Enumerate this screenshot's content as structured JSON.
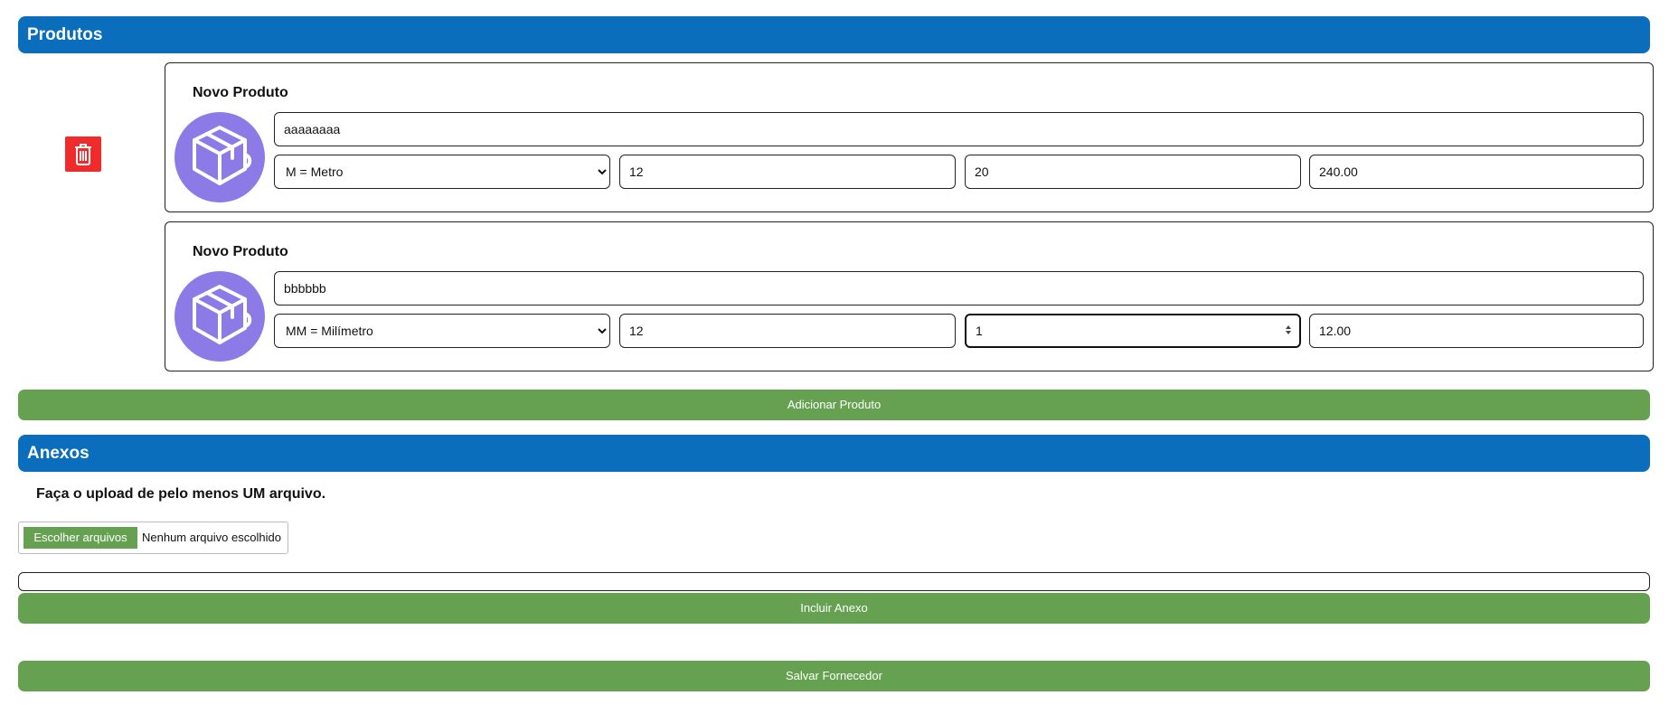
{
  "produtos": {
    "header": "Produtos",
    "items": [
      {
        "title": "Novo Produto",
        "name": "aaaaaaaa",
        "unit": "M = Metro",
        "quantity": "12",
        "price": "20",
        "total": "240.00"
      },
      {
        "title": "Novo Produto",
        "name": "bbbbbb",
        "unit": "MM = Milímetro",
        "quantity": "12",
        "price": "1",
        "total": "12.00"
      }
    ],
    "add_button": "Adicionar Produto"
  },
  "anexos": {
    "header": "Anexos",
    "upload_message": "Faça o upload de pelo menos UM arquivo.",
    "choose_files": "Escolher arquivos",
    "no_file": "Nenhum arquivo escolhido",
    "include_button": "Incluir Anexo"
  },
  "save_button": "Salvar Fornecedor",
  "colors": {
    "header_blue": "#0a6ebd",
    "button_green": "#66a152",
    "delete_red": "#ef2b2b",
    "icon_purple": "#8c7be6"
  },
  "icons": {
    "delete": "trash-icon",
    "product": "package-box-icon"
  }
}
